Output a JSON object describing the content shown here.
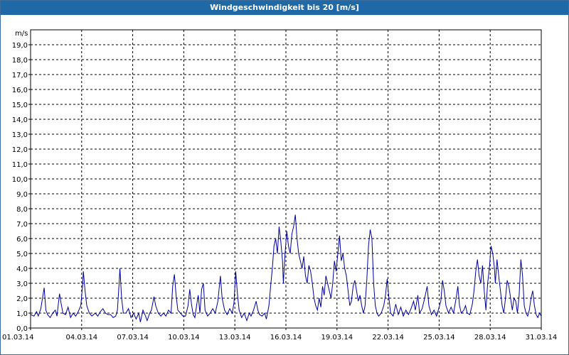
{
  "window": {
    "title": "Windgeschwindigkeit bis 20 [m/s]"
  },
  "chart_data": {
    "type": "line",
    "title": "Windgeschwindigkeit bis 20 [m/s]",
    "unit_label": "m/s",
    "ylim": [
      0,
      20
    ],
    "y_ticks": [
      "0,0",
      "1,0",
      "2,0",
      "3,0",
      "4,0",
      "5,0",
      "6,0",
      "7,0",
      "8,0",
      "9,0",
      "10,0",
      "11,0",
      "12,0",
      "13,0",
      "14,0",
      "15,0",
      "16,0",
      "17,0",
      "18,0",
      "19,0"
    ],
    "x_ticks": [
      "01.03.14",
      "04.03.14",
      "07.03.14",
      "10.03.14",
      "13.03.14",
      "16.03.14",
      "19.03.14",
      "22.03.14",
      "25.03.14",
      "28.03.14",
      "31.03.14"
    ],
    "xlim": [
      0,
      30
    ],
    "grid": true,
    "series_color": "#0000a0",
    "series": [
      {
        "values": [
          [
            0,
            0.9
          ],
          [
            0.2,
            0.8
          ],
          [
            0.35,
            1.1
          ],
          [
            0.45,
            0.8
          ],
          [
            0.6,
            1.3
          ],
          [
            0.8,
            2.7
          ],
          [
            0.9,
            1.2
          ],
          [
            1.0,
            0.9
          ],
          [
            1.15,
            0.7
          ],
          [
            1.3,
            1.0
          ],
          [
            1.45,
            1.2
          ],
          [
            1.55,
            0.8
          ],
          [
            1.7,
            2.3
          ],
          [
            1.8,
            1.6
          ],
          [
            1.9,
            1.0
          ],
          [
            2.05,
            0.9
          ],
          [
            2.2,
            1.4
          ],
          [
            2.35,
            0.7
          ],
          [
            2.5,
            1.0
          ],
          [
            2.65,
            0.8
          ],
          [
            2.8,
            1.1
          ],
          [
            2.95,
            1.5
          ],
          [
            3.05,
            2.8
          ],
          [
            3.1,
            3.8
          ],
          [
            3.2,
            2.5
          ],
          [
            3.3,
            1.5
          ],
          [
            3.45,
            1.0
          ],
          [
            3.6,
            0.8
          ],
          [
            3.8,
            1.0
          ],
          [
            3.95,
            0.8
          ],
          [
            4.1,
            1.1
          ],
          [
            4.25,
            1.3
          ],
          [
            4.4,
            1.0
          ],
          [
            4.55,
            0.9
          ],
          [
            4.7,
            0.9
          ],
          [
            4.85,
            0.7
          ],
          [
            5.0,
            0.8
          ],
          [
            5.1,
            1.2
          ],
          [
            5.2,
            3.0
          ],
          [
            5.25,
            4.0
          ],
          [
            5.35,
            2.0
          ],
          [
            5.45,
            1.0
          ],
          [
            5.6,
            1.0
          ],
          [
            5.75,
            1.3
          ],
          [
            5.9,
            0.7
          ],
          [
            6.05,
            1.0
          ],
          [
            6.2,
            0.6
          ],
          [
            6.35,
            1.0
          ],
          [
            6.45,
            0.4
          ],
          [
            6.6,
            1.2
          ],
          [
            6.75,
            0.8
          ],
          [
            6.85,
            0.5
          ],
          [
            7.0,
            1.0
          ],
          [
            7.1,
            1.2
          ],
          [
            7.25,
            2.1
          ],
          [
            7.35,
            1.5
          ],
          [
            7.5,
            1.0
          ],
          [
            7.65,
            0.8
          ],
          [
            7.8,
            1.0
          ],
          [
            7.95,
            0.8
          ],
          [
            8.1,
            1.2
          ],
          [
            8.25,
            1.0
          ],
          [
            8.35,
            2.8
          ],
          [
            8.45,
            3.6
          ],
          [
            8.55,
            2.2
          ],
          [
            8.65,
            1.2
          ],
          [
            8.8,
            1.0
          ],
          [
            8.95,
            0.8
          ],
          [
            9.1,
            0.8
          ],
          [
            9.25,
            1.5
          ],
          [
            9.35,
            2.6
          ],
          [
            9.45,
            1.6
          ],
          [
            9.55,
            0.9
          ],
          [
            9.65,
            0.7
          ],
          [
            9.75,
            1.5
          ],
          [
            9.85,
            2.2
          ],
          [
            9.95,
            1.0
          ],
          [
            10.05,
            2.6
          ],
          [
            10.15,
            3.0
          ],
          [
            10.25,
            1.2
          ],
          [
            10.4,
            0.8
          ],
          [
            10.55,
            1.0
          ],
          [
            10.7,
            1.3
          ],
          [
            10.85,
            1.0
          ],
          [
            11.0,
            1.8
          ],
          [
            11.15,
            3.5
          ],
          [
            11.25,
            2.0
          ],
          [
            11.4,
            1.2
          ],
          [
            11.55,
            0.9
          ],
          [
            11.7,
            1.3
          ],
          [
            11.85,
            1.0
          ],
          [
            11.95,
            1.7
          ],
          [
            12.05,
            3.8
          ],
          [
            12.15,
            2.3
          ],
          [
            12.25,
            1.2
          ],
          [
            12.4,
            0.7
          ],
          [
            12.55,
            1.0
          ],
          [
            12.7,
            0.5
          ],
          [
            12.85,
            1.0
          ],
          [
            12.95,
            0.8
          ],
          [
            13.1,
            1.2
          ],
          [
            13.25,
            1.8
          ],
          [
            13.35,
            1.2
          ],
          [
            13.45,
            0.9
          ],
          [
            13.6,
            0.8
          ],
          [
            13.75,
            1.0
          ],
          [
            13.85,
            0.6
          ],
          [
            14.0,
            1.5
          ],
          [
            14.1,
            2.8
          ],
          [
            14.2,
            4.0
          ],
          [
            14.3,
            5.5
          ],
          [
            14.4,
            6.0
          ],
          [
            14.5,
            5.0
          ],
          [
            14.6,
            6.8
          ],
          [
            14.7,
            5.8
          ],
          [
            14.8,
            4.5
          ],
          [
            14.85,
            3.0
          ],
          [
            14.95,
            5.0
          ],
          [
            15.05,
            6.5
          ],
          [
            15.15,
            5.5
          ],
          [
            15.25,
            5.0
          ],
          [
            15.35,
            6.3
          ],
          [
            15.45,
            6.8
          ],
          [
            15.55,
            7.6
          ],
          [
            15.65,
            6.0
          ],
          [
            15.75,
            5.0
          ],
          [
            15.85,
            4.5
          ],
          [
            15.95,
            4.0
          ],
          [
            16.05,
            4.8
          ],
          [
            16.15,
            3.5
          ],
          [
            16.25,
            3.0
          ],
          [
            16.35,
            4.2
          ],
          [
            16.45,
            3.8
          ],
          [
            16.55,
            3.0
          ],
          [
            16.65,
            2.0
          ],
          [
            16.75,
            1.5
          ],
          [
            16.85,
            1.2
          ],
          [
            16.95,
            2.0
          ],
          [
            17.05,
            1.4
          ],
          [
            17.15,
            2.8
          ],
          [
            17.25,
            2.2
          ],
          [
            17.35,
            3.5
          ],
          [
            17.45,
            3.0
          ],
          [
            17.55,
            2.5
          ],
          [
            17.65,
            2.0
          ],
          [
            17.75,
            3.0
          ],
          [
            17.85,
            4.5
          ],
          [
            17.95,
            3.8
          ],
          [
            18.05,
            5.0
          ],
          [
            18.15,
            6.2
          ],
          [
            18.25,
            4.5
          ],
          [
            18.35,
            5.0
          ],
          [
            18.45,
            4.0
          ],
          [
            18.55,
            3.5
          ],
          [
            18.65,
            2.5
          ],
          [
            18.75,
            1.5
          ],
          [
            18.85,
            1.8
          ],
          [
            18.95,
            2.8
          ],
          [
            19.05,
            3.2
          ],
          [
            19.15,
            2.5
          ],
          [
            19.25,
            1.8
          ],
          [
            19.35,
            2.2
          ],
          [
            19.45,
            1.5
          ],
          [
            19.55,
            1.0
          ],
          [
            19.65,
            1.5
          ],
          [
            19.75,
            3.2
          ],
          [
            19.85,
            5.5
          ],
          [
            19.95,
            6.6
          ],
          [
            20.05,
            6.0
          ],
          [
            20.15,
            3.0
          ],
          [
            20.25,
            1.5
          ],
          [
            20.35,
            1.0
          ],
          [
            20.45,
            0.8
          ],
          [
            20.6,
            1.0
          ],
          [
            20.75,
            1.5
          ],
          [
            20.85,
            2.2
          ],
          [
            20.95,
            3.3
          ],
          [
            21.05,
            2.0
          ],
          [
            21.15,
            1.0
          ],
          [
            21.3,
            0.8
          ],
          [
            21.45,
            1.6
          ],
          [
            21.6,
            0.9
          ],
          [
            21.75,
            1.4
          ],
          [
            21.9,
            0.8
          ],
          [
            22.05,
            1.2
          ],
          [
            22.2,
            0.9
          ],
          [
            22.35,
            1.3
          ],
          [
            22.5,
            1.8
          ],
          [
            22.6,
            1.2
          ],
          [
            22.75,
            2.2
          ],
          [
            22.85,
            1.0
          ],
          [
            23.0,
            1.3
          ],
          [
            23.15,
            2.0
          ],
          [
            23.3,
            2.8
          ],
          [
            23.4,
            1.5
          ],
          [
            23.55,
            0.9
          ],
          [
            23.7,
            1.2
          ],
          [
            23.85,
            0.8
          ],
          [
            24.0,
            1.4
          ],
          [
            24.1,
            1.8
          ],
          [
            24.2,
            3.2
          ],
          [
            24.3,
            2.5
          ],
          [
            24.4,
            1.5
          ],
          [
            24.55,
            1.0
          ],
          [
            24.7,
            1.4
          ],
          [
            24.85,
            1.0
          ],
          [
            25.0,
            2.0
          ],
          [
            25.1,
            2.8
          ],
          [
            25.2,
            1.5
          ],
          [
            25.3,
            1.0
          ],
          [
            25.45,
            1.2
          ],
          [
            25.55,
            1.5
          ],
          [
            25.65,
            1.0
          ],
          [
            25.8,
            0.9
          ],
          [
            25.95,
            1.6
          ],
          [
            26.05,
            2.5
          ],
          [
            26.15,
            3.8
          ],
          [
            26.25,
            4.6
          ],
          [
            26.35,
            3.5
          ],
          [
            26.45,
            3.0
          ],
          [
            26.55,
            4.2
          ],
          [
            26.65,
            2.5
          ],
          [
            26.75,
            1.2
          ],
          [
            26.85,
            3.0
          ],
          [
            26.95,
            4.0
          ],
          [
            27.05,
            5.5
          ],
          [
            27.15,
            5.0
          ],
          [
            27.25,
            4.0
          ],
          [
            27.3,
            3.0
          ],
          [
            27.4,
            4.6
          ],
          [
            27.5,
            3.5
          ],
          [
            27.6,
            2.5
          ],
          [
            27.7,
            1.5
          ],
          [
            27.8,
            1.0
          ],
          [
            27.9,
            2.0
          ],
          [
            28.0,
            3.2
          ],
          [
            28.1,
            2.8
          ],
          [
            28.2,
            2.0
          ],
          [
            28.3,
            1.2
          ],
          [
            28.4,
            2.0
          ],
          [
            28.5,
            1.8
          ],
          [
            28.6,
            1.0
          ],
          [
            28.7,
            2.2
          ],
          [
            28.8,
            4.6
          ],
          [
            28.9,
            3.5
          ],
          [
            29.0,
            1.5
          ],
          [
            29.1,
            1.0
          ],
          [
            29.2,
            0.8
          ],
          [
            29.3,
            1.2
          ],
          [
            29.4,
            2.0
          ],
          [
            29.5,
            2.5
          ],
          [
            29.6,
            1.5
          ],
          [
            29.7,
            0.9
          ],
          [
            29.8,
            0.7
          ],
          [
            29.9,
            1.0
          ],
          [
            30.0,
            0.8
          ],
          [
            30.1,
            1.0
          ],
          [
            30.2,
            0.8
          ],
          [
            30.3,
            1.2
          ],
          [
            30.4,
            1.0
          ],
          [
            30.5,
            2.4
          ],
          [
            30.6,
            1.0
          ],
          [
            30.75,
            0.8
          ],
          [
            30.9,
            1.0
          ],
          [
            31.0,
            0.8
          ]
        ]
      }
    ]
  }
}
